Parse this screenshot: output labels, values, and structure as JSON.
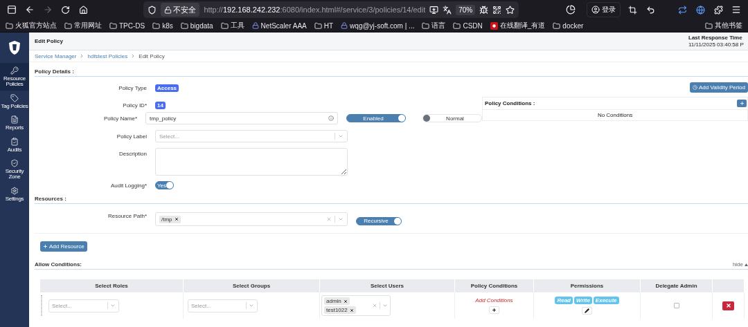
{
  "browser": {
    "url_scheme": "http://",
    "url_host": "192.168.242.232",
    "url_rest": ":6080/index.html#/service/3/policies/14/edit",
    "security": "不安全",
    "zoom": "70%",
    "login": "登录",
    "bookmarks": [
      {
        "label": "火狐官方站点",
        "kind": "folder"
      },
      {
        "label": "常用网址",
        "kind": "folder"
      },
      {
        "label": "TPC-DS",
        "kind": "folder"
      },
      {
        "label": "k8s",
        "kind": "folder"
      },
      {
        "label": "bigdata",
        "kind": "folder"
      },
      {
        "label": "工具",
        "kind": "folder"
      },
      {
        "label": "NetScaler AAA",
        "kind": "site"
      },
      {
        "label": "HT",
        "kind": "folder"
      },
      {
        "label": "wqg@yj-soft.com | ...",
        "kind": "site"
      },
      {
        "label": "语言",
        "kind": "folder"
      },
      {
        "label": "CSDN",
        "kind": "folder"
      },
      {
        "label": "在线翻译_有道",
        "kind": "brand"
      },
      {
        "label": "docker",
        "kind": "folder"
      }
    ],
    "other_bookmarks": "其他书签"
  },
  "sidebar": {
    "items": [
      {
        "label": "Resource Policies",
        "selected": true
      },
      {
        "label": "Tag Policies",
        "selected": false
      },
      {
        "label": "Reports",
        "selected": false
      },
      {
        "label": "Audits",
        "selected": false
      },
      {
        "label": "Security Zone",
        "selected": false
      },
      {
        "label": "Settings",
        "selected": false
      }
    ]
  },
  "header": {
    "title": "Edit Policy",
    "response_label": "Last Response Time",
    "response_time": "11/11/2025 03:40:58 P"
  },
  "breadcrumbs": [
    {
      "label": "Service Manager",
      "link": true
    },
    {
      "label": "hdfstest Policies",
      "link": true
    },
    {
      "label": "Edit Policy",
      "link": false
    }
  ],
  "policy_details": {
    "heading": "Policy Details :",
    "policy_type": {
      "label": "Policy Type",
      "value": "Access"
    },
    "policy_id": {
      "label": "Policy ID*",
      "value": "14"
    },
    "policy_name": {
      "label": "Policy Name*",
      "value": "tmp_policy"
    },
    "status_toggle": {
      "label": "Enabled",
      "on": true
    },
    "override_toggle": {
      "label": "Normal",
      "on": false
    },
    "policy_label": {
      "label": "Policy Label",
      "placeholder": "Select..."
    },
    "description": {
      "label": "Description"
    },
    "audit_logging": {
      "label": "Audit Logging*",
      "toggle": "Yes",
      "on": true
    },
    "validity_button": "Add Validity Period",
    "conditions_panel": {
      "title": "Policy Conditions :",
      "empty": "No Conditions"
    }
  },
  "resources": {
    "heading": "Resources :",
    "path_label": "Resource Path*",
    "values": [
      "/tmp"
    ],
    "recursive": {
      "label": "Recursive",
      "on": true
    },
    "add_button": "Add Resource"
  },
  "allow_conditions": {
    "heading": "Allow Conditions:",
    "hide": "hide",
    "columns": [
      "Select Roles",
      "Select Groups",
      "Select Users",
      "Policy Conditions",
      "Permissions",
      "Delegate Admin"
    ],
    "rows": [
      {
        "roles_placeholder": "Select...",
        "groups_placeholder": "Select...",
        "users": [
          "admin",
          "test1022"
        ],
        "conditions_link": "Add Conditions",
        "permissions": [
          "Read",
          "Write",
          "Execute"
        ],
        "delegate_admin": false
      }
    ]
  }
}
